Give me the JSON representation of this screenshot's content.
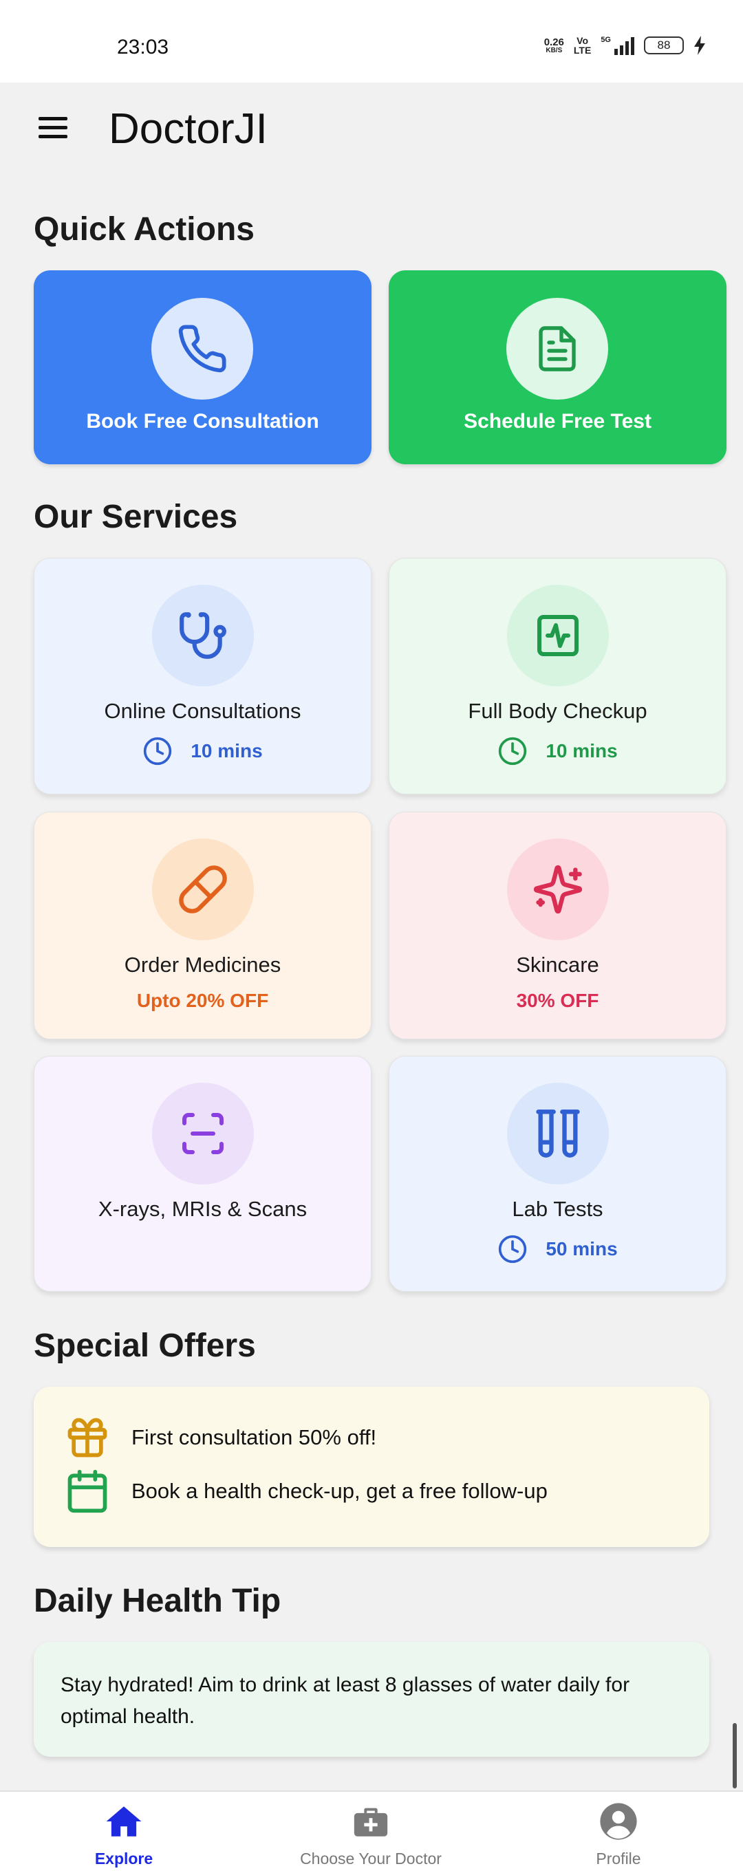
{
  "status_bar": {
    "time": "23:03",
    "net_speed_value": "0.26",
    "net_speed_unit": "KB/S",
    "volte_top": "Vo",
    "volte_bottom": "LTE",
    "network": "5G",
    "battery": "88"
  },
  "app_bar": {
    "title": "DoctorJI",
    "menu_icon": "hamburger-menu-icon"
  },
  "quick_actions": {
    "title": "Quick Actions",
    "items": [
      {
        "label": "Book Free Consultation",
        "icon": "phone-icon",
        "color": "#3b7ff2"
      },
      {
        "label": "Schedule Free Test",
        "icon": "document-icon",
        "color": "#22c55e"
      }
    ]
  },
  "services": {
    "title": "Our Services",
    "items": [
      {
        "name": "Online Consultations",
        "sub": "10 mins",
        "icon": "stethoscope-icon",
        "sub_icon": "clock-icon",
        "accent": "#2f5fd0"
      },
      {
        "name": "Full Body Checkup",
        "sub": "10 mins",
        "icon": "activity-icon",
        "sub_icon": "clock-icon",
        "accent": "#1f9a4b"
      },
      {
        "name": "Order Medicines",
        "sub": "Upto 20% OFF",
        "icon": "pill-icon",
        "accent": "#e2621d"
      },
      {
        "name": "Skincare",
        "sub": "30% OFF",
        "icon": "sparkles-icon",
        "accent": "#d92d54"
      },
      {
        "name": "X-rays, MRIs & Scans",
        "sub": "",
        "icon": "scan-icon",
        "accent": "#8b3fe0"
      },
      {
        "name": "Lab Tests",
        "sub": "50 mins",
        "icon": "test-tubes-icon",
        "sub_icon": "clock-icon",
        "accent": "#2f5fd0"
      }
    ]
  },
  "special_offers": {
    "title": "Special Offers",
    "items": [
      {
        "text": "First consultation 50% off!",
        "icon": "gift-icon",
        "color": "#d4940d"
      },
      {
        "text": "Book a health check-up, get a free follow-up",
        "icon": "calendar-icon",
        "color": "#22a34f"
      }
    ]
  },
  "daily_tip": {
    "title": "Daily Health Tip",
    "text": "Stay hydrated! Aim to drink at least 8 glasses of water daily for optimal health."
  },
  "bottom_nav": {
    "items": [
      {
        "label": "Explore",
        "icon": "home-icon",
        "active": true
      },
      {
        "label": "Choose Your Doctor",
        "icon": "medical-kit-icon",
        "active": false
      },
      {
        "label": "Profile",
        "icon": "profile-icon",
        "active": false
      }
    ]
  }
}
